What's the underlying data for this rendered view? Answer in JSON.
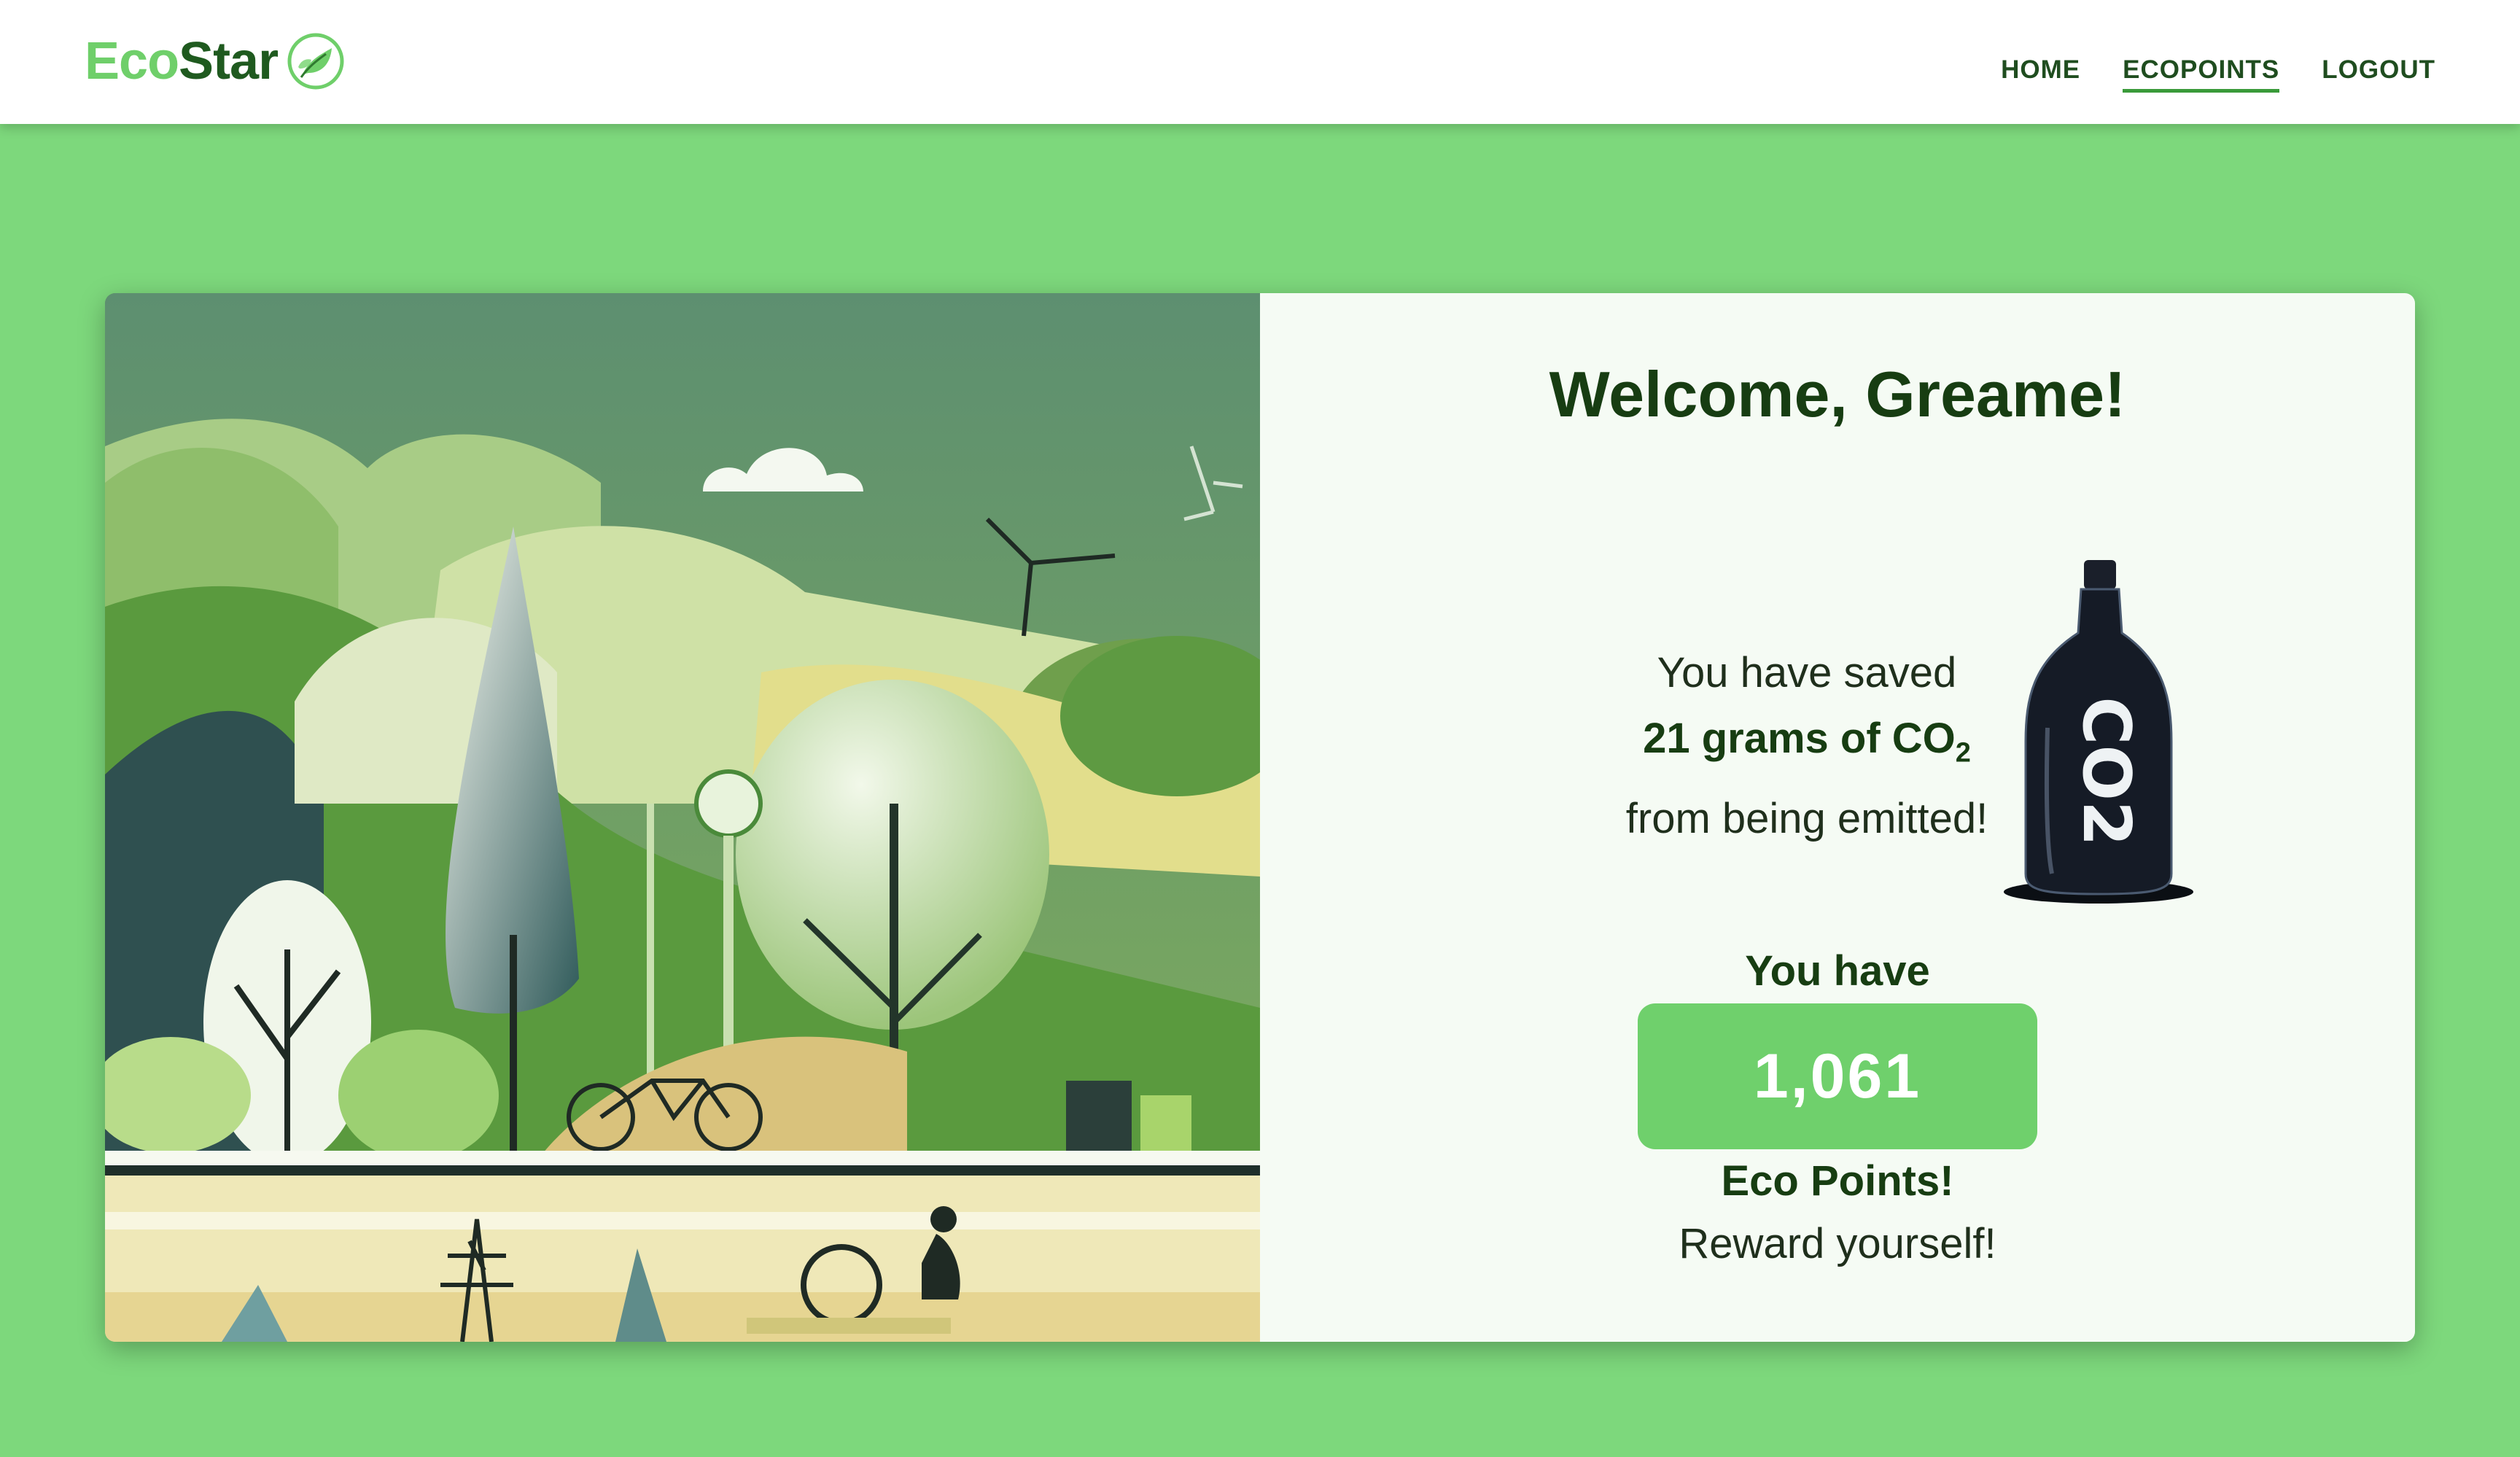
{
  "header": {
    "logo_part1": "Eco",
    "logo_part2": "Star",
    "logo_icon": "leaf-icon",
    "nav": [
      {
        "label": "HOME",
        "active": false
      },
      {
        "label": "ECOPOINTS",
        "active": true
      },
      {
        "label": "LOGOUT",
        "active": false
      }
    ]
  },
  "main": {
    "welcome": "Welcome, Greame!",
    "saved_prefix": "You have saved",
    "saved_amount": "21 grams of CO",
    "saved_amount_sub": "2",
    "saved_suffix": "from being emitted!",
    "bottle_label": "CO2",
    "you_have": "You have",
    "points": "1,061",
    "points_label": "Eco Points!",
    "reward": "Reward yourself!"
  },
  "colors": {
    "background": "#7dd87c",
    "brand_light": "#6fcf6a",
    "brand_dark": "#1f5a1f",
    "points_box": "#6fd06c"
  }
}
